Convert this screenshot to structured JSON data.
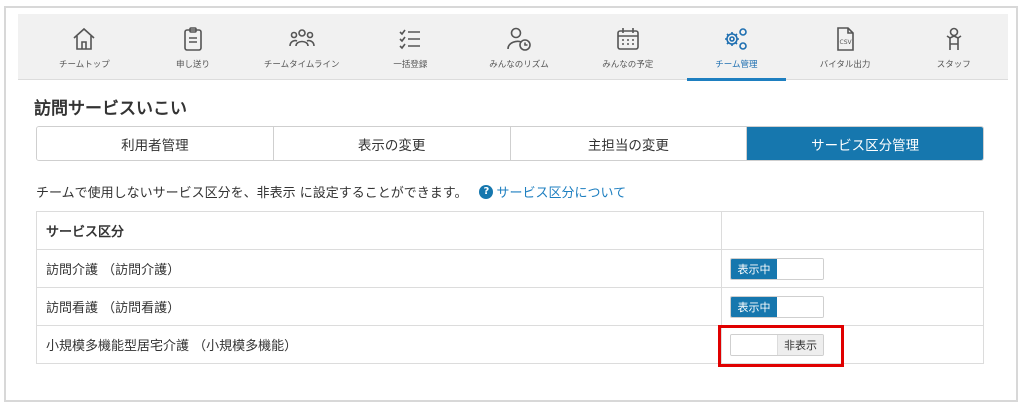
{
  "nav": {
    "items": [
      {
        "label": "チームトップ",
        "icon": "home-icon"
      },
      {
        "label": "申し送り",
        "icon": "clipboard-icon"
      },
      {
        "label": "チームタイムライン",
        "icon": "group-icon"
      },
      {
        "label": "一括登録",
        "icon": "checklist-icon"
      },
      {
        "label": "みんなのリズム",
        "icon": "user-clock-icon"
      },
      {
        "label": "みんなの予定",
        "icon": "calendar-icon"
      },
      {
        "label": "チーム管理",
        "icon": "gears-icon",
        "active": true
      },
      {
        "label": "バイタル出力",
        "icon": "csv-file-icon"
      },
      {
        "label": "スタッフ",
        "icon": "staff-icon"
      }
    ]
  },
  "page": {
    "title": "訪問サービスいこい"
  },
  "tabs": [
    {
      "label": "利用者管理"
    },
    {
      "label": "表示の変更"
    },
    {
      "label": "主担当の変更"
    },
    {
      "label": "サービス区分管理",
      "active": true
    }
  ],
  "description": {
    "text": "チームで使用しないサービス区分を、非表示 に設定することができます。",
    "help_link": "サービス区分について",
    "help_icon": "?"
  },
  "table": {
    "header": "サービス区分",
    "rows": [
      {
        "name": "訪問介護 （訪問介護）",
        "status": "表示中"
      },
      {
        "name": "訪問看護 （訪問看護）",
        "status": "表示中"
      },
      {
        "name": "小規模多機能型居宅介護 （小規模多機能）",
        "status": "非表示"
      }
    ]
  },
  "colors": {
    "accent": "#1677ae",
    "highlight": "#e00000"
  }
}
